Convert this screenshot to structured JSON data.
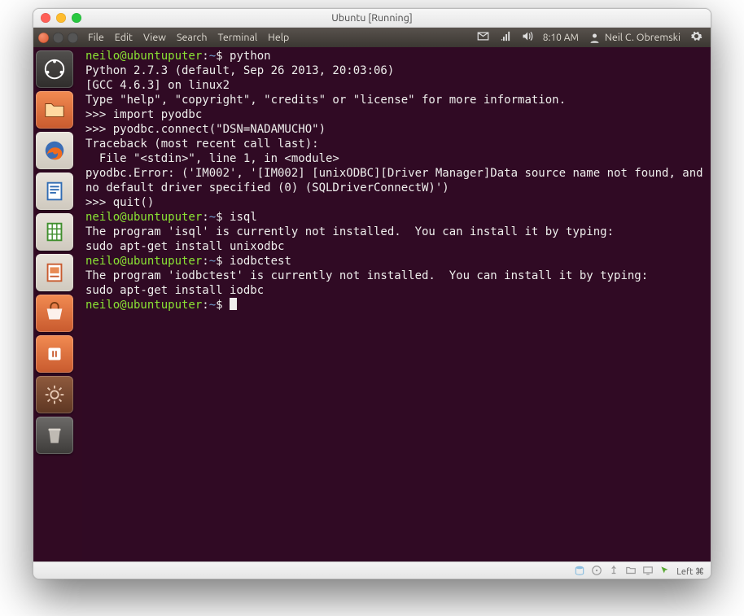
{
  "host_window": {
    "title": "Ubuntu [Running]"
  },
  "panel": {
    "menus": [
      "File",
      "Edit",
      "View",
      "Search",
      "Terminal",
      "Help"
    ],
    "time": "8:10 AM",
    "user": "Neil C. Obremski"
  },
  "launcher_items": [
    {
      "name": "dash",
      "title": "Dash"
    },
    {
      "name": "files",
      "title": "Files"
    },
    {
      "name": "firefox",
      "title": "Firefox"
    },
    {
      "name": "writer",
      "title": "LibreOffice Writer"
    },
    {
      "name": "calc",
      "title": "LibreOffice Calc"
    },
    {
      "name": "impress",
      "title": "LibreOffice Impress"
    },
    {
      "name": "software",
      "title": "Ubuntu Software Center"
    },
    {
      "name": "ubuntuone",
      "title": "Ubuntu One"
    },
    {
      "name": "settings",
      "title": "System Settings"
    },
    {
      "name": "trash",
      "title": "Trash"
    }
  ],
  "terminal": {
    "prompt_user": "neilo@ubuntuputer",
    "prompt_sep": ":",
    "prompt_path": "~",
    "prompt_sym": "$ ",
    "lines": {
      "l01_cmd": "python",
      "l02": "Python 2.7.3 (default, Sep 26 2013, 20:03:06)",
      "l03": "[GCC 4.6.3] on linux2",
      "l04": "Type \"help\", \"copyright\", \"credits\" or \"license\" for more information.",
      "l05": ">>> import pyodbc",
      "l06": ">>> pyodbc.connect(\"DSN=NADAMUCHO\")",
      "l07": "Traceback (most recent call last):",
      "l08": "  File \"<stdin>\", line 1, in <module>",
      "l09": "pyodbc.Error: ('IM002', '[IM002] [unixODBC][Driver Manager]Data source name not found, and no default driver specified (0) (SQLDriverConnectW)')",
      "l10": ">>> quit()",
      "l11_cmd": "isql",
      "l12": "The program 'isql' is currently not installed.  You can install it by typing:",
      "l13": "sudo apt-get install unixodbc",
      "l14_cmd": "iodbctest",
      "l15": "The program 'iodbctest' is currently not installed.  You can install it by typing:",
      "l16": "sudo apt-get install iodbc"
    }
  },
  "mac_status": {
    "left_label": "Left ⌘"
  }
}
